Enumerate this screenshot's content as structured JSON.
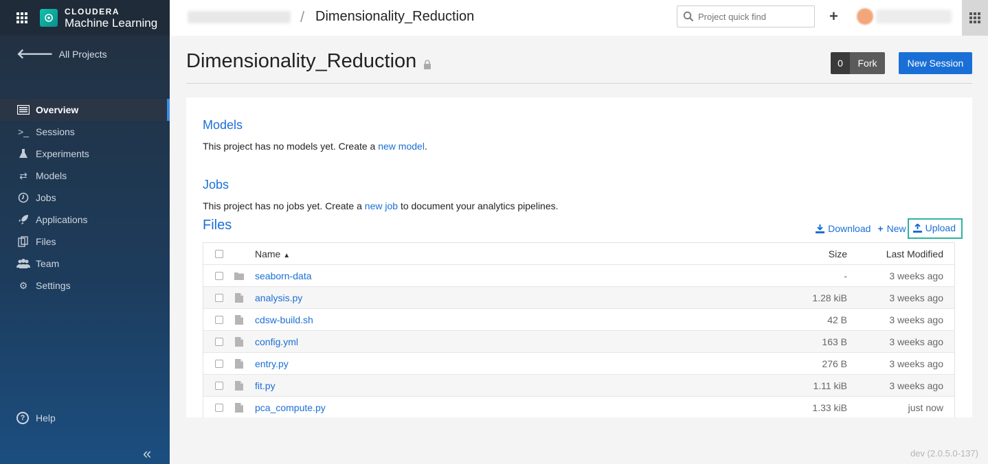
{
  "brand": {
    "company": "CLOUDERA",
    "product": "Machine Learning"
  },
  "sidebar": {
    "back_label": "All Projects",
    "items": [
      {
        "label": "Overview",
        "icon": "overview-icon",
        "active": true
      },
      {
        "label": "Sessions",
        "icon": "terminal-icon"
      },
      {
        "label": "Experiments",
        "icon": "flask-icon"
      },
      {
        "label": "Models",
        "icon": "arrows-icon"
      },
      {
        "label": "Jobs",
        "icon": "clock-icon"
      },
      {
        "label": "Applications",
        "icon": "rocket-icon"
      },
      {
        "label": "Files",
        "icon": "files-icon"
      },
      {
        "label": "Team",
        "icon": "team-icon"
      },
      {
        "label": "Settings",
        "icon": "gear-icon"
      }
    ],
    "help_label": "Help"
  },
  "topbar": {
    "breadcrumb_separator": "/",
    "breadcrumb_title": "Dimensionality_Reduction",
    "search_placeholder": "Project quick find"
  },
  "header": {
    "title": "Dimensionality_Reduction",
    "fork_count": "0",
    "fork_label": "Fork",
    "new_session_label": "New Session"
  },
  "models": {
    "heading": "Models",
    "text_before": "This project has no models yet. Create a ",
    "link": "new model",
    "text_after": "."
  },
  "jobs": {
    "heading": "Jobs",
    "text_before": "This project has no jobs yet. Create a ",
    "link": "new job",
    "text_after": " to document your analytics pipelines."
  },
  "files": {
    "heading": "Files",
    "download_label": "Download",
    "new_label": "New",
    "upload_label": "Upload",
    "columns": {
      "name": "Name",
      "size": "Size",
      "modified": "Last Modified"
    },
    "rows": [
      {
        "type": "folder",
        "name": "seaborn-data",
        "size": "-",
        "modified": "3 weeks ago"
      },
      {
        "type": "file",
        "name": "analysis.py",
        "size": "1.28 kiB",
        "modified": "3 weeks ago"
      },
      {
        "type": "file",
        "name": "cdsw-build.sh",
        "size": "42 B",
        "modified": "3 weeks ago"
      },
      {
        "type": "file",
        "name": "config.yml",
        "size": "163 B",
        "modified": "3 weeks ago"
      },
      {
        "type": "file",
        "name": "entry.py",
        "size": "276 B",
        "modified": "3 weeks ago"
      },
      {
        "type": "file",
        "name": "fit.py",
        "size": "1.11 kiB",
        "modified": "3 weeks ago"
      },
      {
        "type": "file",
        "name": "pca_compute.py",
        "size": "1.33 kiB",
        "modified": "just now"
      }
    ]
  },
  "footer": {
    "version": "dev (2.0.5.0-137)"
  },
  "colors": {
    "accent": "#1a6fd6",
    "highlight": "#2bb39e",
    "sidebar": "#1d3c5c"
  }
}
